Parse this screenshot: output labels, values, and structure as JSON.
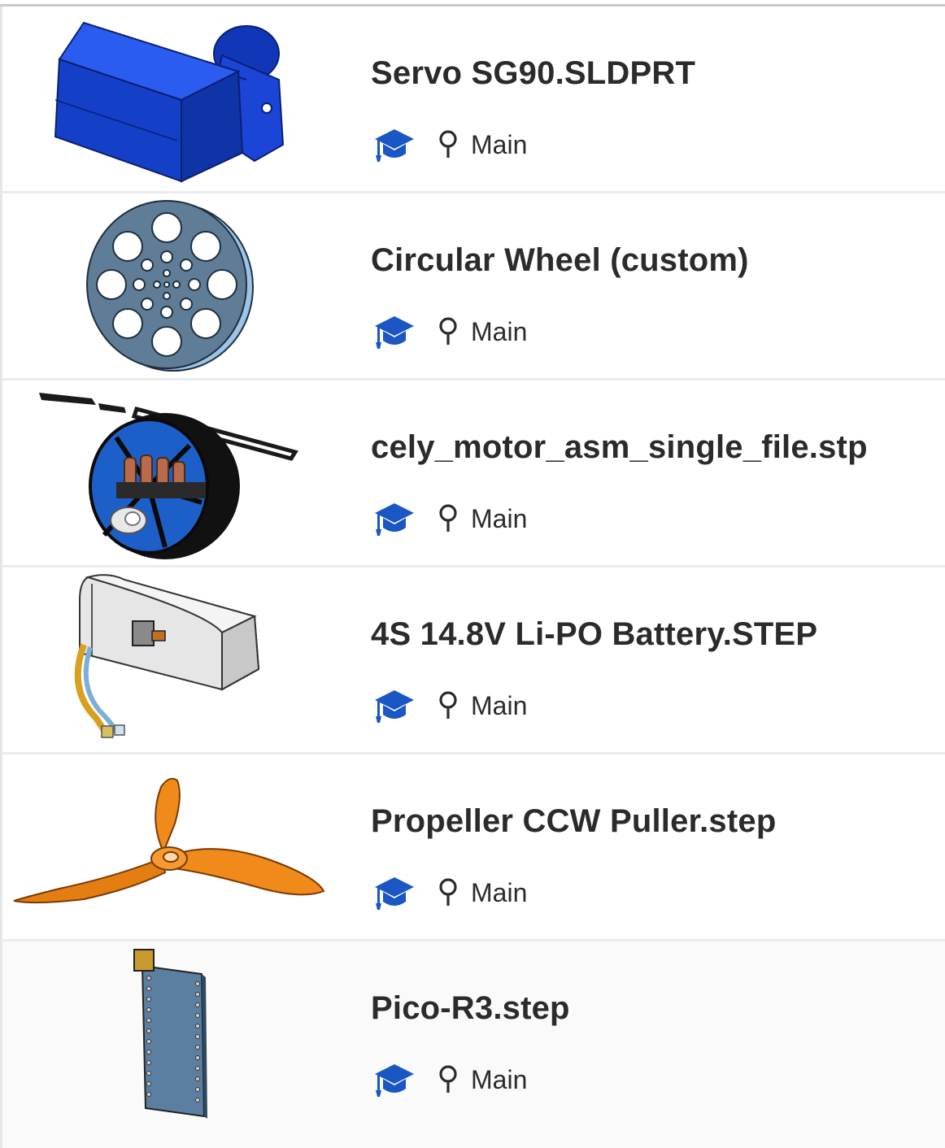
{
  "colors": {
    "accent_blue": "#1a56c4",
    "text": "#2b2b2b"
  },
  "documents": [
    {
      "name": "Servo SG90.SLDPRT",
      "badge_icon": "graduation-cap-icon",
      "branch_icon": "branch-pin-icon",
      "branch": "Main",
      "thumbnail": "servo-thumbnail"
    },
    {
      "name": "Circular Wheel (custom)",
      "badge_icon": "graduation-cap-icon",
      "branch_icon": "branch-pin-icon",
      "branch": "Main",
      "thumbnail": "wheel-thumbnail"
    },
    {
      "name": "cely_motor_asm_single_file.stp",
      "badge_icon": "graduation-cap-icon",
      "branch_icon": "branch-pin-icon",
      "branch": "Main",
      "thumbnail": "motor-thumbnail"
    },
    {
      "name": "4S 14.8V Li-PO Battery.STEP",
      "badge_icon": "graduation-cap-icon",
      "branch_icon": "branch-pin-icon",
      "branch": "Main",
      "thumbnail": "battery-thumbnail"
    },
    {
      "name": "Propeller CCW Puller.step",
      "badge_icon": "graduation-cap-icon",
      "branch_icon": "branch-pin-icon",
      "branch": "Main",
      "thumbnail": "propeller-thumbnail"
    },
    {
      "name": "Pico-R3.step",
      "badge_icon": "graduation-cap-icon",
      "branch_icon": "branch-pin-icon",
      "branch": "Main",
      "thumbnail": "pico-board-thumbnail"
    }
  ]
}
